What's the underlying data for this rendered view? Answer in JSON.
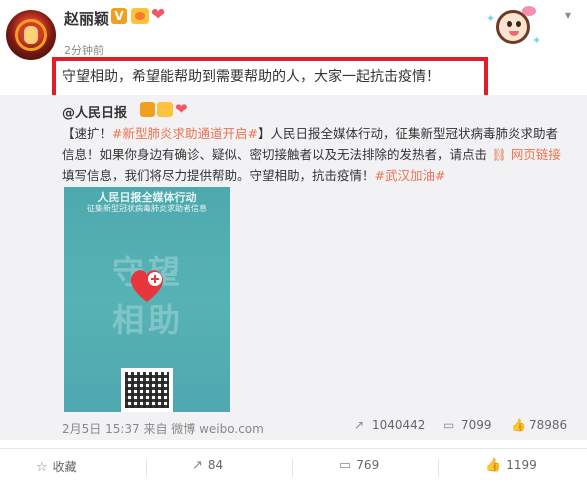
{
  "post": {
    "username": "赵丽颖",
    "badge_v": "V",
    "posted_time": "2分钟前",
    "text": "守望相助，希望能帮助到需要帮助的人，大家一起抗击疫情！"
  },
  "repost": {
    "author": "@人民日报",
    "text_prefix": "【速扩！",
    "tag1": "#新型肺炎求助通道开启#",
    "text_middle": "】人民日报全媒体行动，征集新型冠状病毒肺炎求助者信息！如果你身边有确诊、疑似、密切接触者以及无法排除的发热者，请点击",
    "link_label": "网页链接",
    "text_after_link": " 填写信息，我们将尽力提供帮助。守望相助，抗击疫情！",
    "tag2": "#武汉加油#",
    "poster": {
      "title": "人民日报全媒体行动",
      "subtitle": "征集新型冠状病毒肺炎求助者信息",
      "big_line1": "守望",
      "big_line2": "相助"
    },
    "meta": "2月5日 15:37 来自 微博 weibo.com",
    "stats": {
      "reposts": "1040442",
      "comments": "7099",
      "likes": "78986"
    }
  },
  "actions": {
    "favorite": "收藏",
    "repost": "84",
    "comment": "769",
    "like": "1199"
  },
  "colors": {
    "highlight_border": "#e41c2a",
    "tag_color": "#eb7350",
    "repost_bg": "#f2f2f5"
  }
}
